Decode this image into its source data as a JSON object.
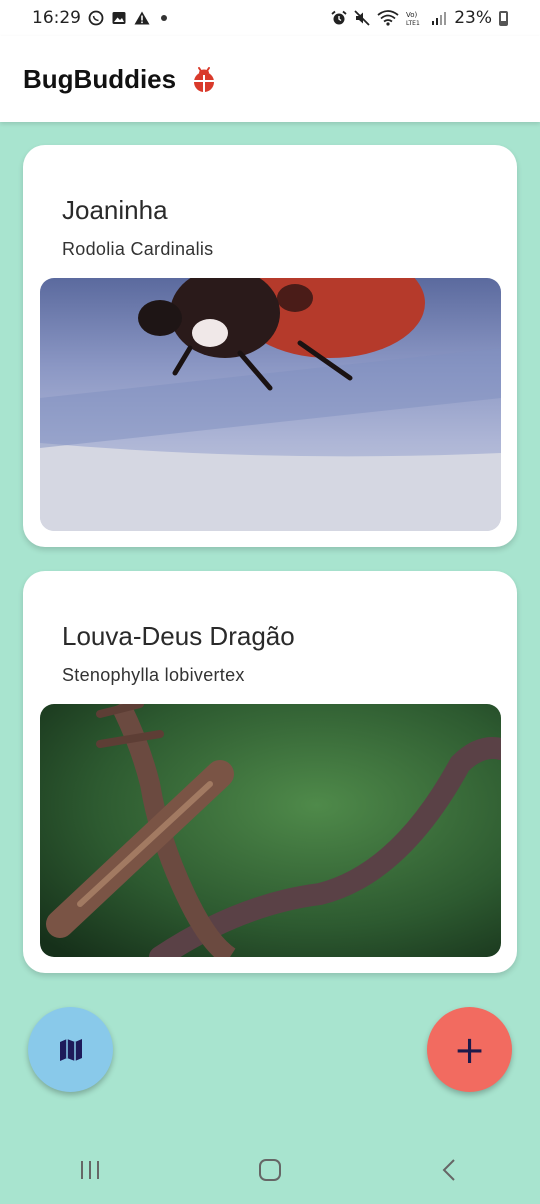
{
  "status_bar": {
    "time": "16:29",
    "battery": "23%"
  },
  "app": {
    "title": "BugBuddies",
    "accent": "#d93a2b"
  },
  "cards": [
    {
      "title": "Joaninha",
      "subtitle": "Rodolia Cardinalis",
      "image": "ladybug-photo"
    },
    {
      "title": "Louva-Deus Dragão",
      "subtitle": "Stenophylla lobivertex",
      "image": "mantis-photo"
    }
  ],
  "fabs": {
    "map_icon": "map-icon",
    "add_icon": "plus-icon",
    "map_color": "#89c9ea",
    "add_color": "#f26b60"
  },
  "nav": {
    "recent": "recent-apps-icon",
    "home": "home-icon",
    "back": "back-icon"
  }
}
